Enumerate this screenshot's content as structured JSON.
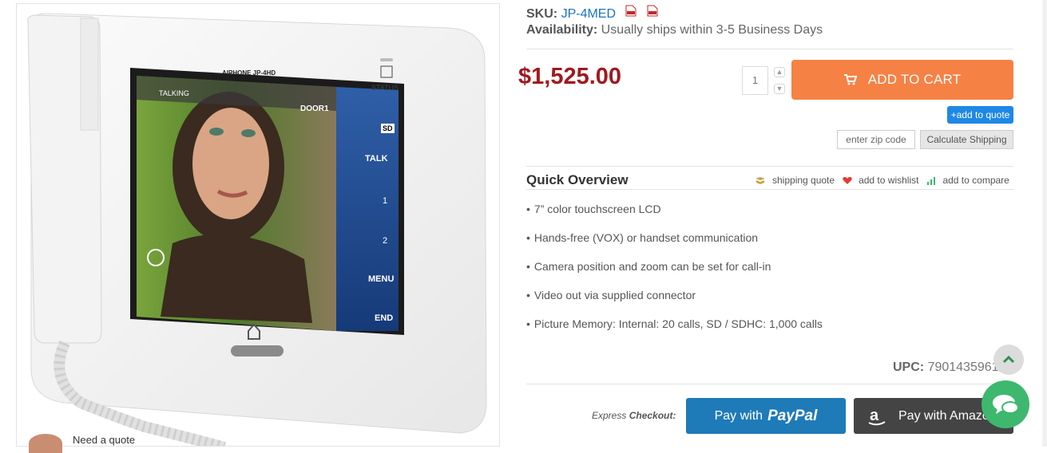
{
  "product": {
    "sku_label": "SKU:",
    "sku_value": "JP-4MED",
    "availability_label": "Availability:",
    "availability_value": "Usually ships within 3-5 Business Days",
    "price": "$1,525.00",
    "quantity": "1",
    "upc_label": "UPC:",
    "upc_value": "790143596177"
  },
  "device": {
    "brand_text": "AIPHONE JP-4HD",
    "status_label": "STATUS",
    "talking_label": "TALKING",
    "door_label": "DOOR1",
    "sd_label": "SD",
    "buttons": [
      {
        "label": "TALK"
      },
      {
        "label": "1"
      },
      {
        "label": "2"
      },
      {
        "label": "MENU"
      },
      {
        "label": "END"
      }
    ]
  },
  "cart": {
    "add_to_cart_label": "ADD TO CART",
    "add_to_quote_label": "+add to quote",
    "zip_placeholder": "enter zip code",
    "calc_shipping_label": "Calculate Shipping"
  },
  "overview": {
    "title": "Quick Overview",
    "links": [
      {
        "label": "shipping quote",
        "icon": "truck-icon",
        "color": "#c9a24a"
      },
      {
        "label": "add to wishlist",
        "icon": "heart-icon",
        "color": "#e53935"
      },
      {
        "label": "add to compare",
        "icon": "bar-chart-icon",
        "color": "#3db86e"
      }
    ],
    "features": [
      "7” color touchscreen LCD",
      "Hands-free (VOX) or handset communication",
      "Camera position and zoom can be set for call-in",
      "Video out via supplied connector",
      "Picture Memory: Internal: 20 calls, SD / SDHC: 1,000 calls"
    ]
  },
  "checkout": {
    "express_prefix": "Express",
    "express_bold": "Checkout:",
    "paypal_prefix": "Pay with",
    "paypal_brand": "PayPal",
    "amazon_label": "Pay with Amazon"
  },
  "widgets": {
    "need_quote": "Need a quote"
  },
  "colors": {
    "price": "#a0191f",
    "add_to_cart": "#f68145",
    "quote": "#1e88e5",
    "paypal": "#1f7ab8",
    "amazon": "#444444",
    "chat": "#3db86e"
  }
}
